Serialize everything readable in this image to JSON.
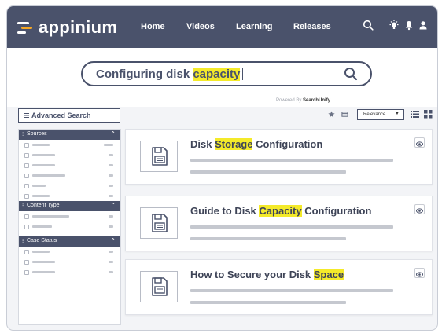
{
  "brand": {
    "name": "appinium",
    "logo_colors": [
      "#ffffff",
      "#f5a623"
    ]
  },
  "nav": {
    "links": [
      "Home",
      "Videos",
      "Learning",
      "Releases"
    ],
    "icons": [
      "search-icon",
      "lightbulb-icon",
      "bell-icon",
      "user-icon"
    ]
  },
  "search": {
    "query_prefix": "Configuring disk ",
    "query_highlight": "capacity",
    "powered_by_prefix": "Powered By",
    "powered_by_brand": "SearchUnify"
  },
  "toolbar": {
    "advanced_search": "Advanced Search",
    "sort_value": "Relevance",
    "icons": [
      "star-icon",
      "bookmark-icon",
      "list-view-icon",
      "grid-view-icon"
    ]
  },
  "facets": [
    {
      "title": "Sources",
      "rows": 7
    },
    {
      "title": "Content Type",
      "rows": 2
    },
    {
      "title": "Case Status",
      "rows": 3
    }
  ],
  "results": [
    {
      "before": "Disk ",
      "highlight": "Storage",
      "after": " Configuration"
    },
    {
      "before": "Guide to Disk ",
      "highlight": "Capacity",
      "after": " Configuration"
    },
    {
      "before": "How to Secure your Disk ",
      "highlight": "Space",
      "after": ""
    }
  ],
  "colors": {
    "nav_bg": "#4a526b",
    "highlight": "#f4ea2a",
    "accent": "#f5a623",
    "placeholder_gray": "#c5c8cf"
  }
}
